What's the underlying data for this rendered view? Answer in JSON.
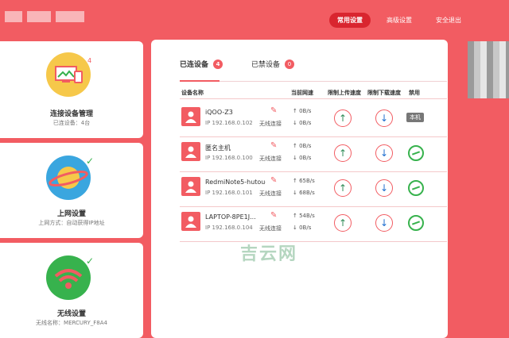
{
  "topnav": [
    {
      "label": "常用设置",
      "active": true
    },
    {
      "label": "高级设置",
      "active": false
    },
    {
      "label": "安全退出",
      "active": false
    }
  ],
  "cards": [
    {
      "title": "连接设备管理",
      "sub": "已连设备：4台",
      "badge": "4"
    },
    {
      "title": "上网设置",
      "sub": "上网方式：自动获得IP地址"
    },
    {
      "title": "无线设置",
      "sub": "无线名称：MERCURY_F8A4"
    }
  ],
  "tabs": [
    {
      "label": "已连设备",
      "count": "4"
    },
    {
      "label": "已禁设备",
      "count": "0"
    }
  ],
  "columns": [
    "设备名称",
    "当前网速",
    "限制上传速度",
    "限制下载速度",
    "禁用"
  ],
  "devices": [
    {
      "name": "iQOO-Z3",
      "ip": "IP 192.168.0.102",
      "conn": "无线连接",
      "up": "0B/s",
      "down": "0B/s",
      "action": "本机"
    },
    {
      "name": "匿名主机",
      "ip": "IP 192.168.0.100",
      "conn": "无线连接",
      "up": "0B/s",
      "down": "0B/s",
      "action": "ban"
    },
    {
      "name": "RedmiNote5-hutoude..",
      "ip": "IP 192.168.0.101",
      "conn": "无线连接",
      "up": "65B/s",
      "down": "68B/s",
      "action": "ban"
    },
    {
      "name": "LAPTOP-8PE1J...",
      "ip": "IP 192.168.0.104",
      "conn": "无线连接",
      "up": "54B/s",
      "down": "0B/s",
      "action": "ban"
    }
  ],
  "watermark": "吉云网",
  "colors": {
    "accent": "#f25c62",
    "green": "#37b24d"
  }
}
